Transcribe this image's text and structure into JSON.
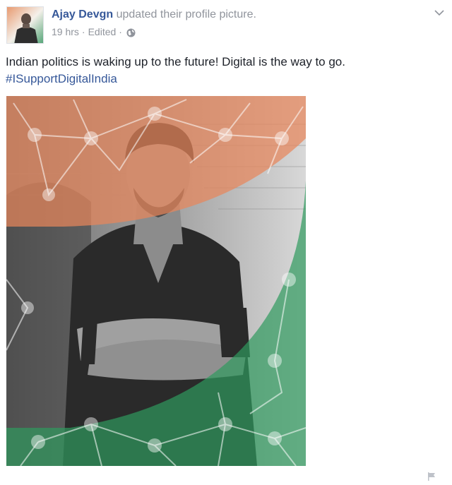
{
  "post": {
    "author": "Ajay Devgn",
    "action_text": "updated their profile picture.",
    "time": "19 hrs",
    "separator": "·",
    "edited": "Edited",
    "status_text": "Indian politics is waking up to the future! Digital is the way to go.",
    "hashtag": "#ISupportDigitalIndia",
    "icons": {
      "privacy": "globe-icon",
      "options": "chevron-down-icon",
      "report": "flag-icon"
    },
    "colors": {
      "link": "#365899",
      "meta": "#90949c",
      "saffron": "#e8875b",
      "green": "#3a9a62"
    }
  }
}
